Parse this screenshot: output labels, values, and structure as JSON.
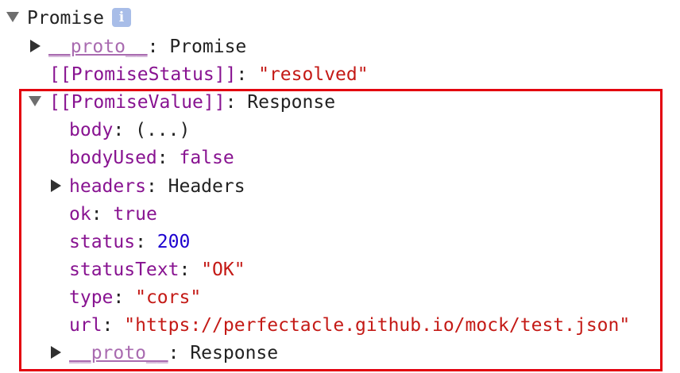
{
  "root": {
    "label": "Promise",
    "info_glyph": "i"
  },
  "promise_proto": {
    "key": "__proto__",
    "value": "Promise"
  },
  "promise_status": {
    "key": "[[PromiseStatus]]",
    "value": "\"resolved\""
  },
  "promise_value": {
    "key": "[[PromiseValue]]",
    "value": "Response"
  },
  "response_props": {
    "body": {
      "key": "body",
      "value": "(...)"
    },
    "bodyUsed": {
      "key": "bodyUsed",
      "value": "false"
    },
    "headers": {
      "key": "headers",
      "value": "Headers"
    },
    "ok": {
      "key": "ok",
      "value": "true"
    },
    "status": {
      "key": "status",
      "value": "200"
    },
    "statusText": {
      "key": "statusText",
      "value": "\"OK\""
    },
    "type": {
      "key": "type",
      "value": "\"cors\""
    },
    "url": {
      "key": "url",
      "value": "\"https://perfectacle.github.io/mock/test.json\""
    },
    "proto": {
      "key": "__proto__",
      "value": "Response"
    }
  },
  "separator": ": ",
  "colors": {
    "key": "#881391",
    "key_dim": "#a96bb0",
    "string": "#c41a16",
    "number": "#1c00cf",
    "highlight_border": "#e3000f"
  }
}
